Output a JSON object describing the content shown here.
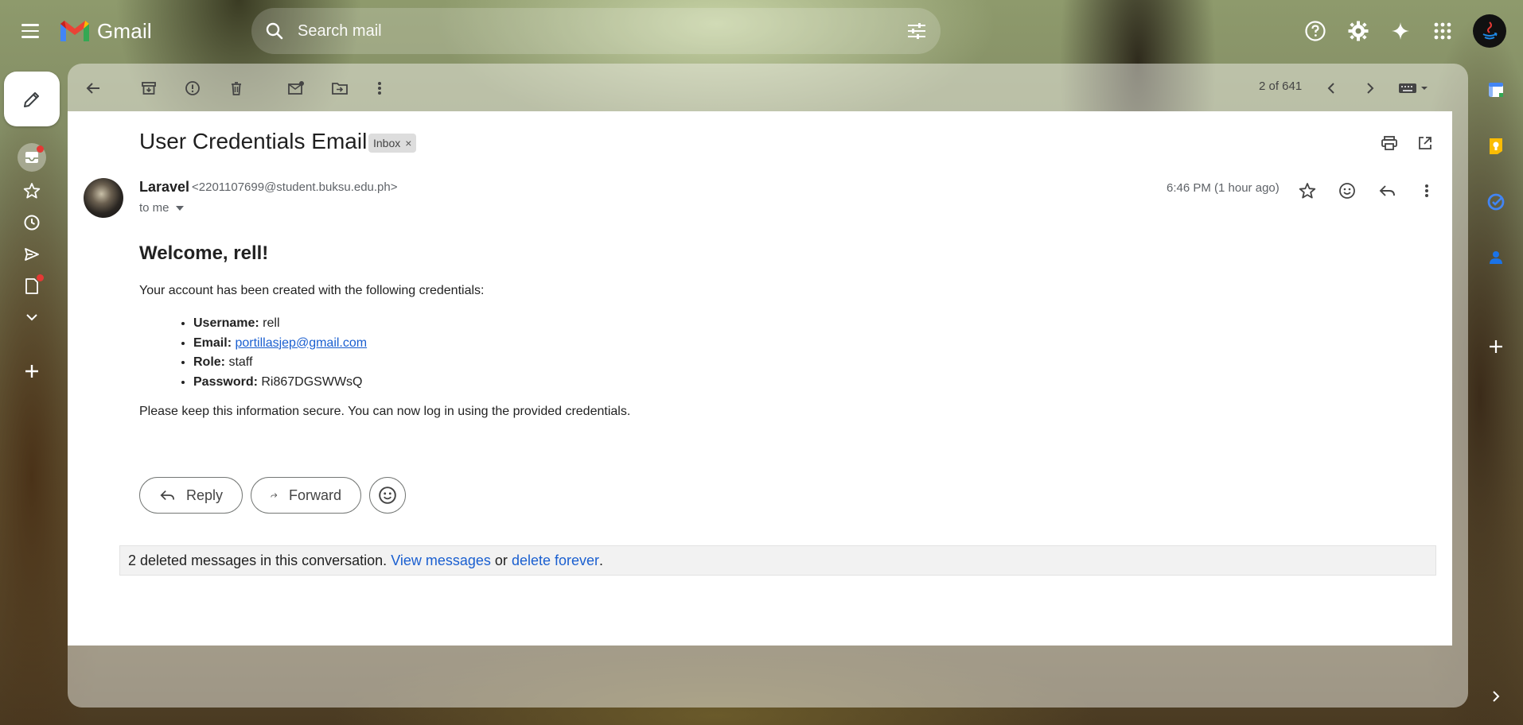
{
  "app": {
    "name": "Gmail",
    "brand_colors": {
      "red": "#ea4335",
      "blue": "#4285f4",
      "green": "#34a853",
      "yellow": "#fbbc04"
    }
  },
  "search": {
    "placeholder": "Search mail",
    "value": ""
  },
  "header_icons": [
    "support-icon",
    "settings-icon",
    "gemini-icon",
    "apps-grid-icon",
    "account-avatar"
  ],
  "left_rail": [
    "compose-icon",
    "inbox-icon",
    "starred-icon",
    "snoozed-icon",
    "sent-icon",
    "drafts-icon",
    "more-icon",
    "add-label-icon"
  ],
  "toolbar": {
    "icons": [
      "back-icon",
      "archive-icon",
      "report-spam-icon",
      "delete-icon",
      "mark-unread-icon",
      "move-to-icon",
      "more-vert-icon"
    ],
    "pager": "2 of 641"
  },
  "email": {
    "subject": "User Credentials Email",
    "label_chip": "Inbox",
    "label_close": "×",
    "sender_name": "Laravel",
    "sender_email": "<2201107699@student.buksu.edu.ph>",
    "recipient": "to me",
    "timestamp": "6:46 PM (1 hour ago)",
    "body": {
      "greeting": "Welcome, rell!",
      "intro": "Your account has been created with the following credentials:",
      "credentials": [
        {
          "label": "Username:",
          "value": "rell"
        },
        {
          "label": "Email:",
          "value": "portillasjep@gmail.com",
          "is_link": true
        },
        {
          "label": "Role:",
          "value": "staff"
        },
        {
          "label": "Password:",
          "value": "Ri867DGSWWsQ"
        }
      ],
      "outro": "Please keep this information secure. You can now log in using the provided credentials."
    }
  },
  "actions": {
    "reply": "Reply",
    "forward": "Forward"
  },
  "deleted_notice": {
    "text": "2 deleted messages in this conversation.",
    "view_link": "View messages",
    "or": "or",
    "delete_link": "delete forever",
    "period": "."
  },
  "right_rail": [
    "calendar-icon",
    "keep-icon",
    "tasks-icon",
    "contacts-icon",
    "add-addon-icon",
    "expand-panel-icon"
  ]
}
